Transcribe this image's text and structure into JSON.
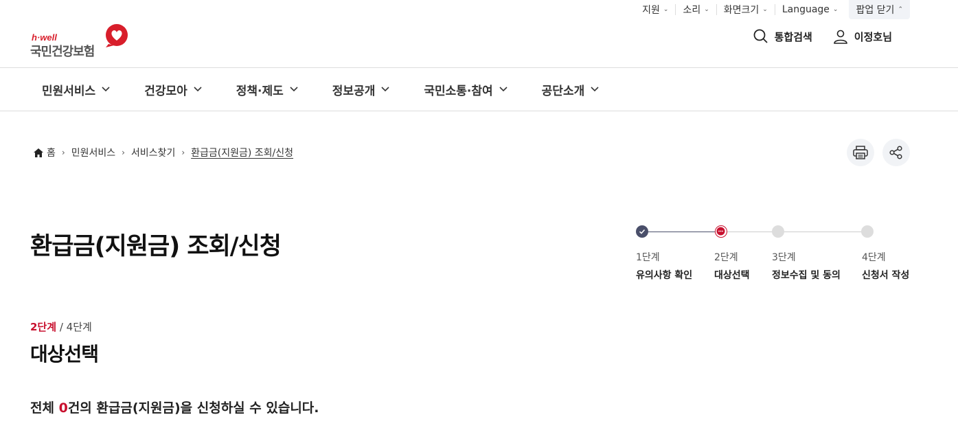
{
  "utility": {
    "support": "지원",
    "sound": "소리",
    "screen_size": "화면크기",
    "language": "Language",
    "popup_close": "팝업 닫기"
  },
  "logo": {
    "tagline": "h·well",
    "name": "국민건강보험"
  },
  "header": {
    "search": "통합검색",
    "user": "이정호님"
  },
  "gnb": [
    "민원서비스",
    "건강모아",
    "정책·제도",
    "정보공개",
    "국민소통·참여",
    "공단소개"
  ],
  "breadcrumb": {
    "home": "홈",
    "level1": "민원서비스",
    "level2": "서비스찾기",
    "current": "환급금(지원금) 조회/신청"
  },
  "page_title": "환급금(지원금) 조회/신청",
  "stepper": {
    "steps": [
      {
        "label": "1단계",
        "name": "유의사항 확인",
        "state": "done"
      },
      {
        "label": "2단계",
        "name": "대상선택",
        "state": "current"
      },
      {
        "label": "3단계",
        "name": "정보수집 및 동의",
        "state": "todo"
      },
      {
        "label": "4단계",
        "name": "신청서 작성",
        "state": "todo"
      }
    ]
  },
  "step_counter": {
    "current": "2단계",
    "total": "/ 4단계"
  },
  "section_title": "대상선택",
  "summary": {
    "prefix": "전체 ",
    "count": "0",
    "suffix": "건의 환급금(지원금)을 신청하실 수 있습니다."
  },
  "colors": {
    "brand_red": "#c8102e",
    "done_dot": "#4a4f6a",
    "todo_dot": "#dddddd"
  }
}
